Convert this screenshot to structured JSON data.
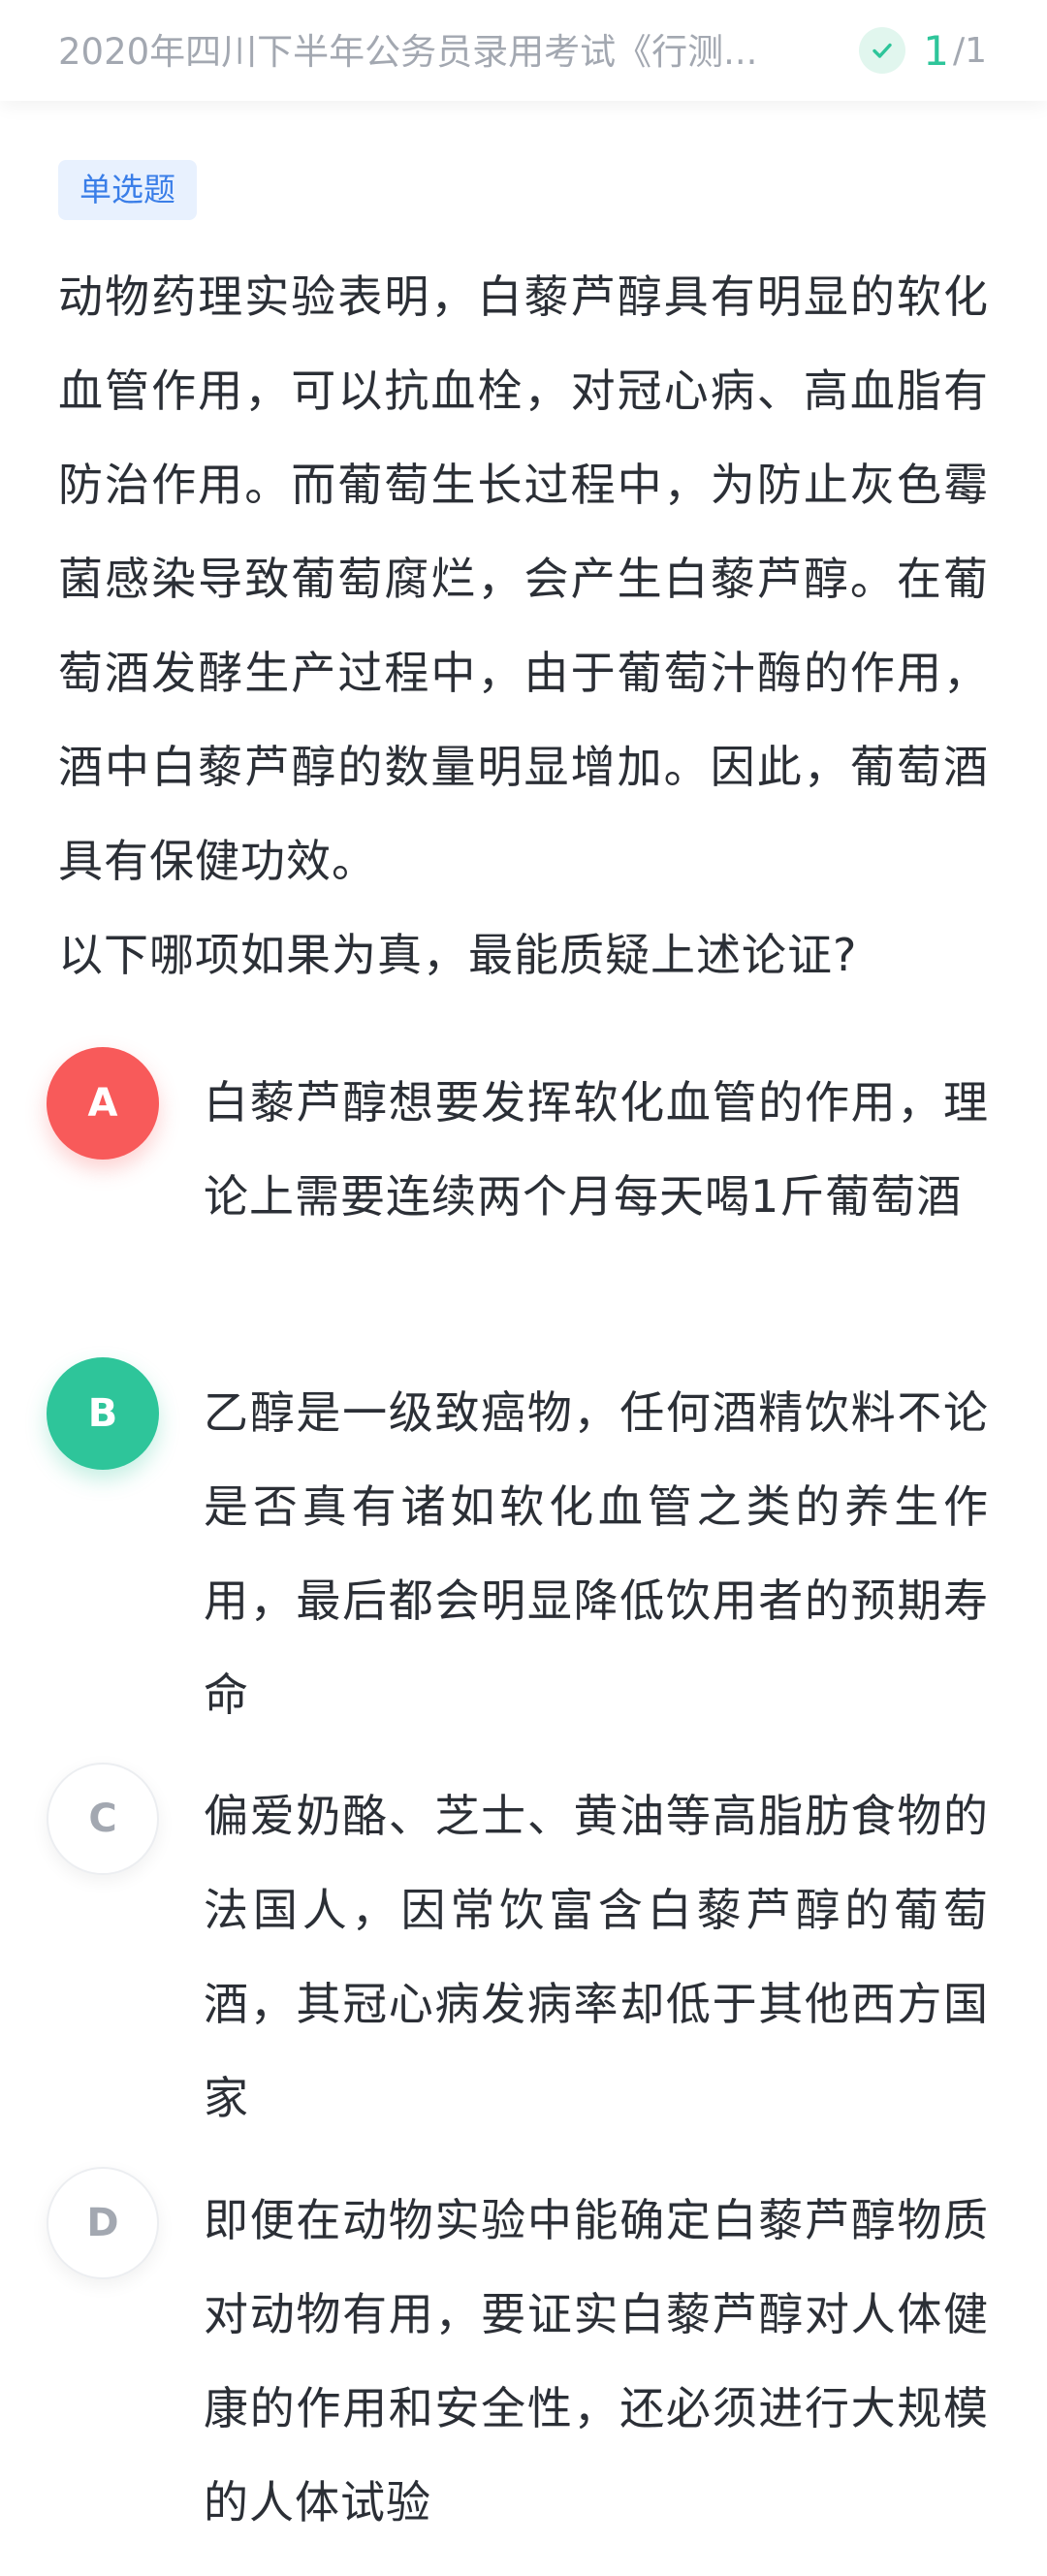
{
  "header": {
    "title": "2020年四川下半年公务员录用考试《行测...",
    "progress_current": "1",
    "progress_sep": "/",
    "progress_total": "1"
  },
  "question": {
    "type_tag": "单选题",
    "stem": "动物药理实验表明，白藜芦醇具有明显的软化血管作用，可以抗血栓，对冠心病、高血脂有防治作用。而葡萄生长过程中，为防止灰色霉菌感染导致葡萄腐烂，会产生白藜芦醇。在葡萄酒发酵生产过程中，由于葡萄汁酶的作用，酒中白藜芦醇的数量明显增加。因此，葡萄酒具有保健功效。",
    "prompt": "以下哪项如果为真，最能质疑上述论证?"
  },
  "options": [
    {
      "letter": "A",
      "state": "wrong",
      "text": "白藜芦醇想要发挥软化血管的作用，理论上需要连续两个月每天喝1斤葡萄酒"
    },
    {
      "letter": "B",
      "state": "correct",
      "text": "乙醇是一级致癌物，任何酒精饮料不论是否真有诸如软化血管之类的养生作用，最后都会明显降低饮用者的预期寿命"
    },
    {
      "letter": "C",
      "state": "normal",
      "text": "偏爱奶酪、芝士、黄油等高脂肪食物的法国人，因常饮富含白藜芦醇的葡萄酒，其冠心病发病率却低于其他西方国家"
    },
    {
      "letter": "D",
      "state": "normal",
      "text": "即便在动物实验中能确定白藜芦醇物质对动物有用，要证实白藜芦醇对人体健康的作用和安全性，还必须进行大规模的人体试验"
    }
  ],
  "colors": {
    "correct": "#2ec59a",
    "wrong": "#f85a5a",
    "tag_text": "#3a7ee8",
    "tag_bg": "#e8f1fe",
    "muted": "#a3a8b1"
  }
}
